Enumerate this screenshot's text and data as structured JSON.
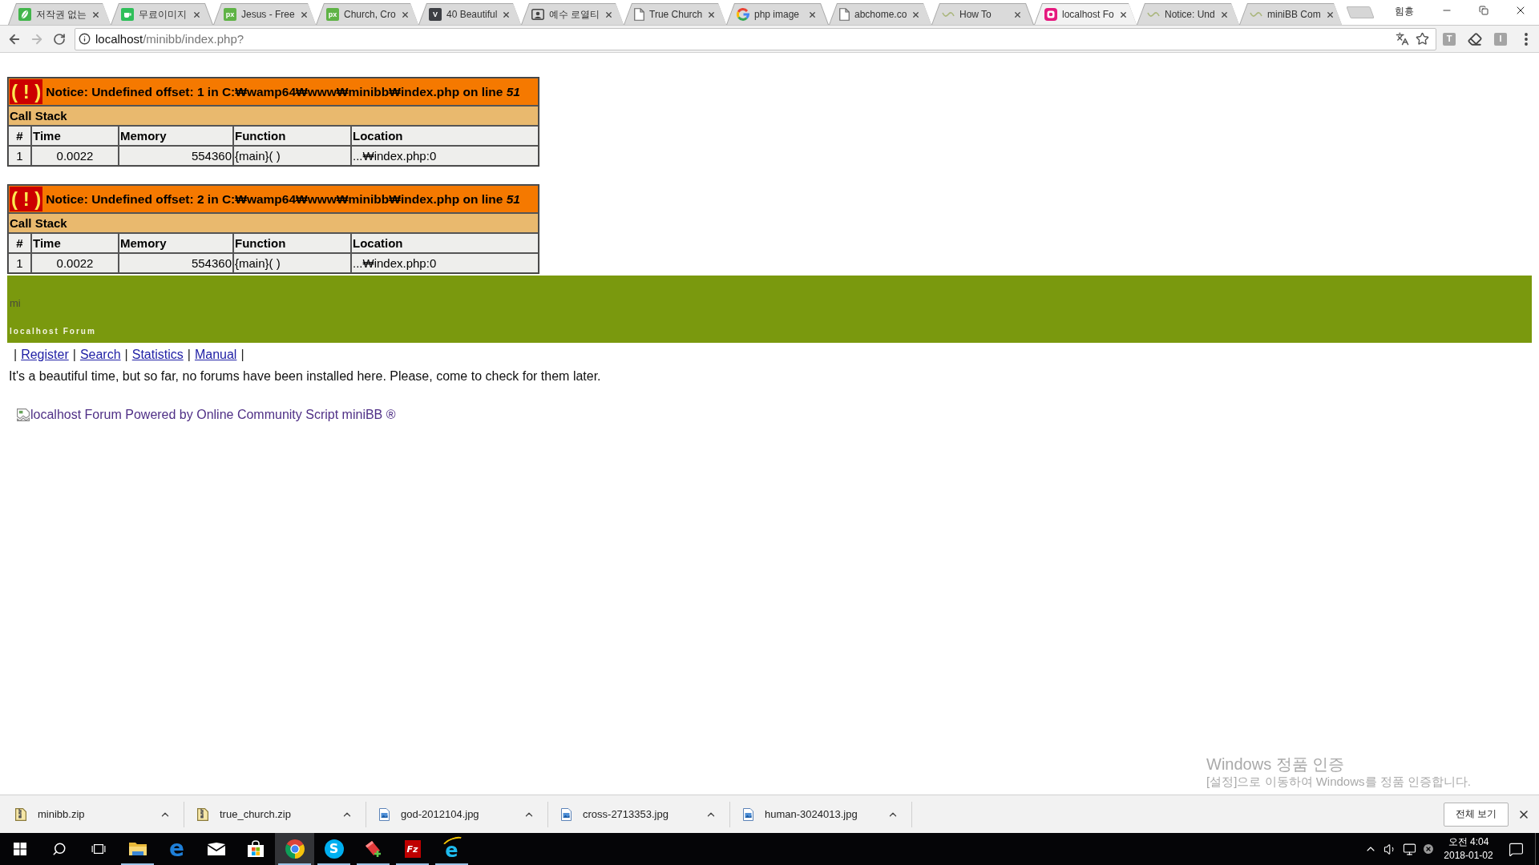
{
  "browser": {
    "tabs": [
      {
        "title": "저작권 없는",
        "favicon": {
          "kind": "leaf"
        },
        "selected": false
      },
      {
        "title": "무료이미지",
        "favicon": {
          "kind": "cup"
        },
        "selected": false
      },
      {
        "title": "Jesus - Free",
        "favicon": {
          "kind": "tile",
          "text": "px",
          "color": "#5fb346"
        },
        "selected": false
      },
      {
        "title": "Church, Cro",
        "favicon": {
          "kind": "tile",
          "text": "px",
          "color": "#5fb346"
        },
        "selected": false
      },
      {
        "title": "40 Beautiful",
        "favicon": {
          "kind": "tile",
          "text": "V",
          "color": "#3d3f44"
        },
        "selected": false
      },
      {
        "title": "예수 로열티",
        "favicon": {
          "kind": "portrait"
        },
        "selected": false
      },
      {
        "title": "True Church",
        "favicon": {
          "kind": "page"
        },
        "selected": false
      },
      {
        "title": "php image",
        "favicon": {
          "kind": "ring"
        },
        "selected": false
      },
      {
        "title": "abchome.co",
        "favicon": {
          "kind": "page"
        },
        "selected": false
      },
      {
        "title": "How To",
        "favicon": {
          "kind": "loading"
        },
        "selected": false
      },
      {
        "title": "localhost Fo",
        "favicon": {
          "kind": "wamp"
        },
        "selected": true
      },
      {
        "title": "Notice: Und",
        "favicon": {
          "kind": "loading"
        },
        "selected": false
      },
      {
        "title": "miniBB Com",
        "favicon": {
          "kind": "loading"
        },
        "selected": false
      }
    ],
    "profile_name": "힘흉",
    "address": {
      "host": "localhost",
      "path": "/minibb/index.php?"
    },
    "extensions": [
      {
        "kind": "letter",
        "text": "T"
      },
      {
        "kind": "eraser"
      },
      {
        "kind": "letter",
        "text": "I"
      }
    ]
  },
  "errors": [
    {
      "badge": "( ! )",
      "message": "Notice: Undefined offset: 1 in C:₩wamp64₩www₩minibb₩index.php on line *51*",
      "call_stack_title": "Call Stack",
      "columns": [
        "#",
        "Time",
        "Memory",
        "Function",
        "Location"
      ],
      "rows": [
        [
          "1",
          "0.0022",
          "554360",
          "{main}( )",
          "...₩index.php:0"
        ]
      ]
    },
    {
      "badge": "( ! )",
      "message": "Notice: Undefined offset: 2 in C:₩wamp64₩www₩minibb₩index.php on line *51*",
      "call_stack_title": "Call Stack",
      "columns": [
        "#",
        "Time",
        "Memory",
        "Function",
        "Location"
      ],
      "rows": [
        [
          "1",
          "0.0022",
          "554360",
          "{main}( )",
          "...₩index.php:0"
        ]
      ]
    }
  ],
  "forum": {
    "logo_text": "mi",
    "title": "localhost Forum",
    "nav": [
      {
        "kind": "separator",
        "text": "|"
      },
      {
        "kind": "link",
        "text": "Register"
      },
      {
        "kind": "separator",
        "text": "|"
      },
      {
        "kind": "link",
        "text": "Search"
      },
      {
        "kind": "separator",
        "text": "|"
      },
      {
        "kind": "link",
        "text": "Statistics"
      },
      {
        "kind": "separator",
        "text": "|"
      },
      {
        "kind": "link",
        "text": "Manual"
      },
      {
        "kind": "separator",
        "text": "|"
      }
    ],
    "message": "It's a beautiful time, but so far, no forums have been installed here. Please, come to check for them later.",
    "footer_link": "localhost Forum Powered by Online Community Script miniBB ®"
  },
  "activation_notice": {
    "title": "Windows 정품 인증",
    "text": "[설정]으로 이동하여 Windows를 정품 인증합니다."
  },
  "downloads": {
    "items": [
      {
        "kind": "zip",
        "name": "minibb.zip"
      },
      {
        "kind": "zip",
        "name": "true_church.zip"
      },
      {
        "kind": "image",
        "name": "god-2012104.jpg"
      },
      {
        "kind": "image",
        "name": "cross-2713353.jpg"
      },
      {
        "kind": "image",
        "name": "human-3024013.jpg"
      }
    ],
    "show_all": "전체 보기"
  },
  "taskbar": {
    "items": [
      {
        "kind": "start",
        "running": false,
        "selected": false
      },
      {
        "kind": "search",
        "running": false,
        "selected": false
      },
      {
        "kind": "taskview",
        "running": false,
        "selected": false
      },
      {
        "kind": "explorer",
        "running": true,
        "selected": false
      },
      {
        "kind": "edge",
        "glyph": "e",
        "running": false,
        "selected": false
      },
      {
        "kind": "mail",
        "running": false,
        "selected": false
      },
      {
        "kind": "store",
        "running": false,
        "selected": false
      },
      {
        "kind": "chrome",
        "running": true,
        "selected": true
      },
      {
        "kind": "skype",
        "glyph": "S",
        "running": true,
        "selected": false
      },
      {
        "kind": "paint",
        "running": true,
        "selected": false
      },
      {
        "kind": "filezilla",
        "glyph": "Fz",
        "running": true,
        "selected": false
      },
      {
        "kind": "ie",
        "glyph": "e",
        "running": true,
        "selected": false
      }
    ],
    "clock": {
      "time": "오전 4:04",
      "date": "2018-01-02"
    }
  }
}
